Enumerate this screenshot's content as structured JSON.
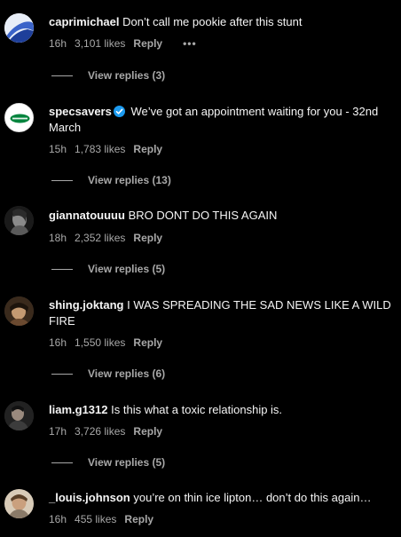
{
  "comments": [
    {
      "username": "caprimichael",
      "text": "Don’t call me pookie after this stunt",
      "time": "16h",
      "likes": "3,101 likes",
      "reply_label": "Reply",
      "more_label": "•••",
      "view_replies": "View replies (3)",
      "avatar_icon": "blue-swoosh-avatar"
    },
    {
      "username": "specsavers",
      "verified": true,
      "text": "We’ve got an appointment waiting for you - 32nd March",
      "time": "15h",
      "likes": "1,783 likes",
      "reply_label": "Reply",
      "view_replies": "View replies (13)",
      "avatar_icon": "specsavers-logo-avatar"
    },
    {
      "username": "giannatouuuu",
      "text": "BRO DONT DO THIS AGAIN",
      "time": "18h",
      "likes": "2,352 likes",
      "reply_label": "Reply",
      "view_replies": "View replies (5)",
      "avatar_icon": "photo-avatar"
    },
    {
      "username": "shing.joktang",
      "text": "I WAS SPREADING THE SAD NEWS LIKE A WILD FIRE",
      "time": "16h",
      "likes": "1,550 likes",
      "reply_label": "Reply",
      "view_replies": "View replies (6)",
      "avatar_icon": "photo-avatar"
    },
    {
      "username": "liam.g1312",
      "text": "Is this what a toxic relationship is.",
      "time": "17h",
      "likes": "3,726 likes",
      "reply_label": "Reply",
      "view_replies": "View replies (5)",
      "avatar_icon": "photo-avatar"
    },
    {
      "username": "_louis.johnson",
      "text": "you’re on thin ice lipton… don’t do this again…",
      "time": "16h",
      "likes": "455 likes",
      "reply_label": "Reply",
      "avatar_icon": "photo-avatar"
    }
  ],
  "colors": {
    "background": "#000000",
    "text": "#f5f5f5",
    "secondary": "#a8a8a8",
    "verified": "#1d9bf0",
    "specsavers_green": "#00843d"
  }
}
